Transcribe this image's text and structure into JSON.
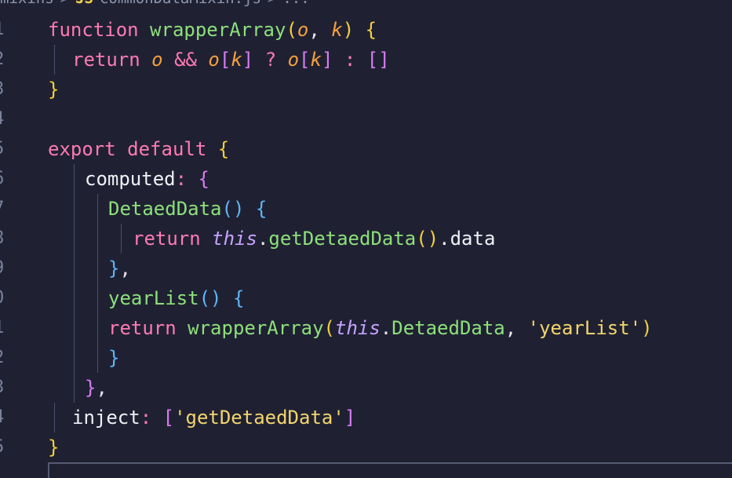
{
  "breadcrumb": {
    "folder": "mixins",
    "sep1": ">",
    "lang_badge": "JS",
    "file": "commonDataMixin.js",
    "sep2": ">",
    "more": "..."
  },
  "line_numbers": [
    "1",
    "2",
    "3",
    "4",
    "5",
    "6",
    "7",
    "8",
    "9",
    "0",
    "1",
    "2",
    "3",
    "4",
    "5"
  ],
  "code": {
    "l1": {
      "kw": "function",
      "fn": "wrapperArray",
      "p1": "(",
      "a1": "o",
      "comma": ", ",
      "a2": "k",
      "p2": ")",
      "b": "{"
    },
    "l2": {
      "kw": "return",
      "a1": "o",
      "op": "&&",
      "a2": "o",
      "lb1": "[",
      "k1": "k",
      "rb1": "]",
      "q": "?",
      "a3": "o",
      "lb2": "[",
      "k2": "k",
      "rb2": "]",
      "c": ":",
      "arr": "[]"
    },
    "l3": {
      "b": "}"
    },
    "l5": {
      "kw1": "export",
      "kw2": "default",
      "b": "{"
    },
    "l6": {
      "prop": "computed",
      "colon": ":",
      "b": "{"
    },
    "l7": {
      "fn": "DetaedData",
      "parens": "()",
      "b": "{"
    },
    "l8": {
      "kw": "return",
      "tz": "this",
      "dot": ".",
      "fn": "getDetaedData",
      "parens": "()",
      "tail": ".data"
    },
    "l9": {
      "b": "}",
      "comma": ","
    },
    "l10": {
      "fn": "yearList",
      "parens": "()",
      "b": "{"
    },
    "l11": {
      "kw": "return",
      "fn": "wrapperArray",
      "p1": "(",
      "tz": "this",
      "dot": ".",
      "prop": "DetaedData",
      "comma": ", ",
      "str": "'yearList'",
      "p2": ")"
    },
    "l12": {
      "b": "}"
    },
    "l13": {
      "b": "}",
      "comma": ","
    },
    "l14": {
      "prop": "inject",
      "colon": ":",
      "lb": "[",
      "str": "'getDetaedData'",
      "rb": "]"
    },
    "l15": {
      "b": "}"
    }
  }
}
